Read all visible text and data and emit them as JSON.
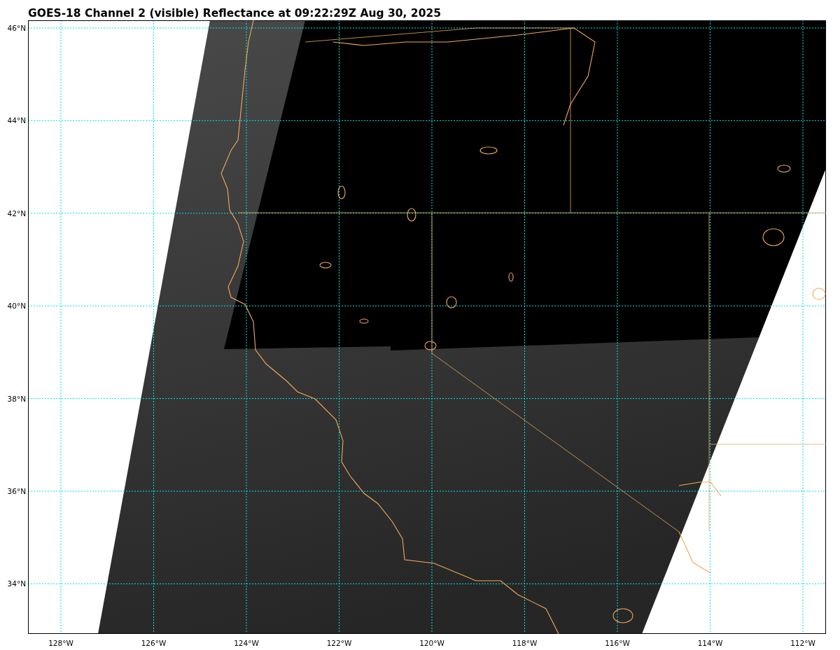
{
  "title": "GOES-18 Channel 2 (visible) Reflectance at 09:22:29Z Aug 30, 2025",
  "map": {
    "lat_labels": [
      "46°N",
      "44°N",
      "42°N",
      "40°N",
      "38°N",
      "36°N",
      "34°N"
    ],
    "lon_labels": [
      "128°W",
      "126°W",
      "124°W",
      "122°W",
      "120°W",
      "118°W",
      "116°W",
      "114°W",
      "112°W"
    ]
  }
}
